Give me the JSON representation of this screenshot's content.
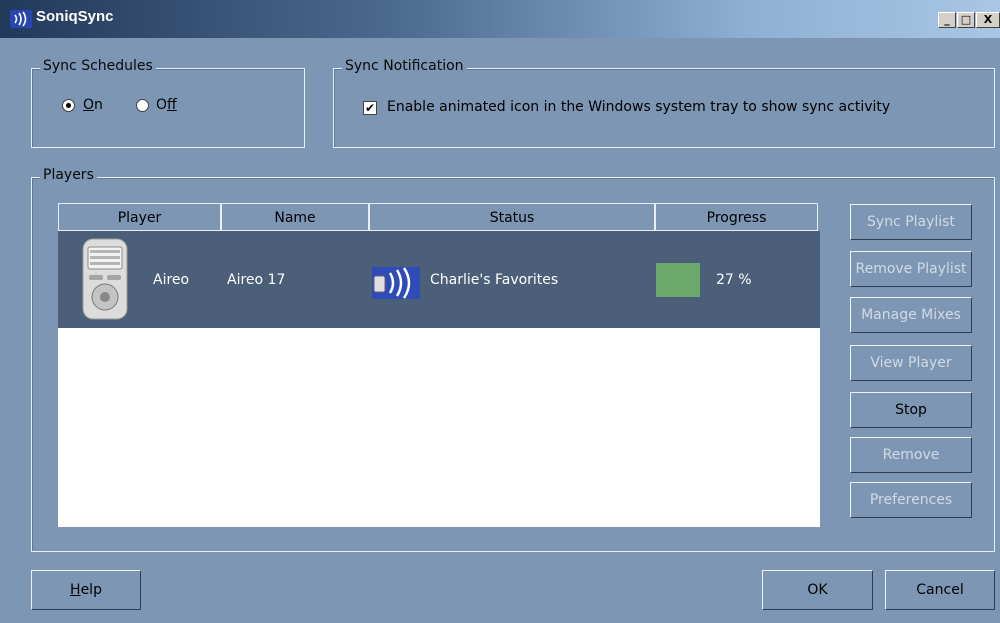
{
  "window": {
    "title": "SoniqSync",
    "minimize": "_",
    "maximize": "□",
    "close": "X"
  },
  "sync_schedules": {
    "legend": "Sync Schedules",
    "on_mnemonic": "O",
    "on_rest": "n",
    "off_prefix": "O",
    "off_mnemonic": "f",
    "off_rest": "f",
    "selected": "On"
  },
  "sync_notification": {
    "legend": "Sync Notification",
    "checkbox_label": "Enable animated icon in the Windows system tray to show sync activity",
    "checked": true
  },
  "players": {
    "legend": "Players",
    "columns": [
      "Player",
      "Name",
      "Status",
      "Progress"
    ],
    "rows": [
      {
        "player": "Aireo",
        "name": "Aireo 17",
        "status": "Charlie's Favorites",
        "progress_percent": 27,
        "progress_label": "27 %"
      }
    ]
  },
  "side_buttons": [
    {
      "label": "Sync Playlist",
      "enabled": false
    },
    {
      "label": "Remove Playlist",
      "enabled": false
    },
    {
      "label": "Manage Mixes",
      "enabled": false
    },
    {
      "label": "View Player",
      "enabled": false
    },
    {
      "label": "Stop",
      "enabled": true
    },
    {
      "label": "Remove",
      "enabled": false
    },
    {
      "label": "Preferences",
      "enabled": false
    }
  ],
  "bottom_buttons": {
    "help_mnemonic": "H",
    "help_rest": "elp",
    "ok": "OK",
    "cancel": "Cancel"
  },
  "colors": {
    "window_bg": "#7c96b3",
    "selected_row": "#4b5f79",
    "progress_fill": "#6ba86b",
    "device_icon_bg": "#2746b4"
  }
}
